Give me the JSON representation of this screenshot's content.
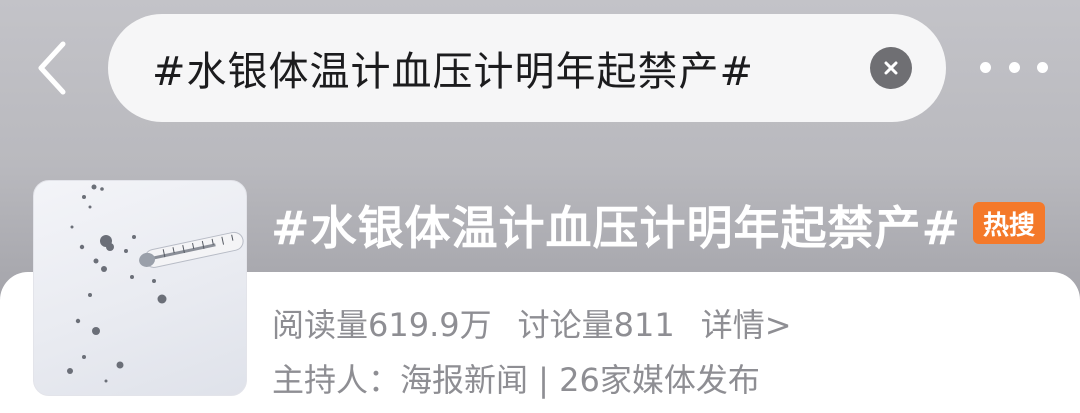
{
  "search": {
    "query": "#水银体温计血压计明年起禁产#"
  },
  "topic": {
    "title": "#水银体温计血压计明年起禁产#",
    "badge": "热搜",
    "reads": "阅读量619.9万",
    "discussions": "讨论量811",
    "details": "详情>",
    "host": "主持人：海报新闻 | 26家媒体发布"
  },
  "icons": {
    "back": "chevron-left-icon",
    "clear": "close-circle-icon",
    "more": "more-dots-icon"
  },
  "colors": {
    "badge": "#f4792a",
    "secondary_text": "#8e8e93"
  }
}
